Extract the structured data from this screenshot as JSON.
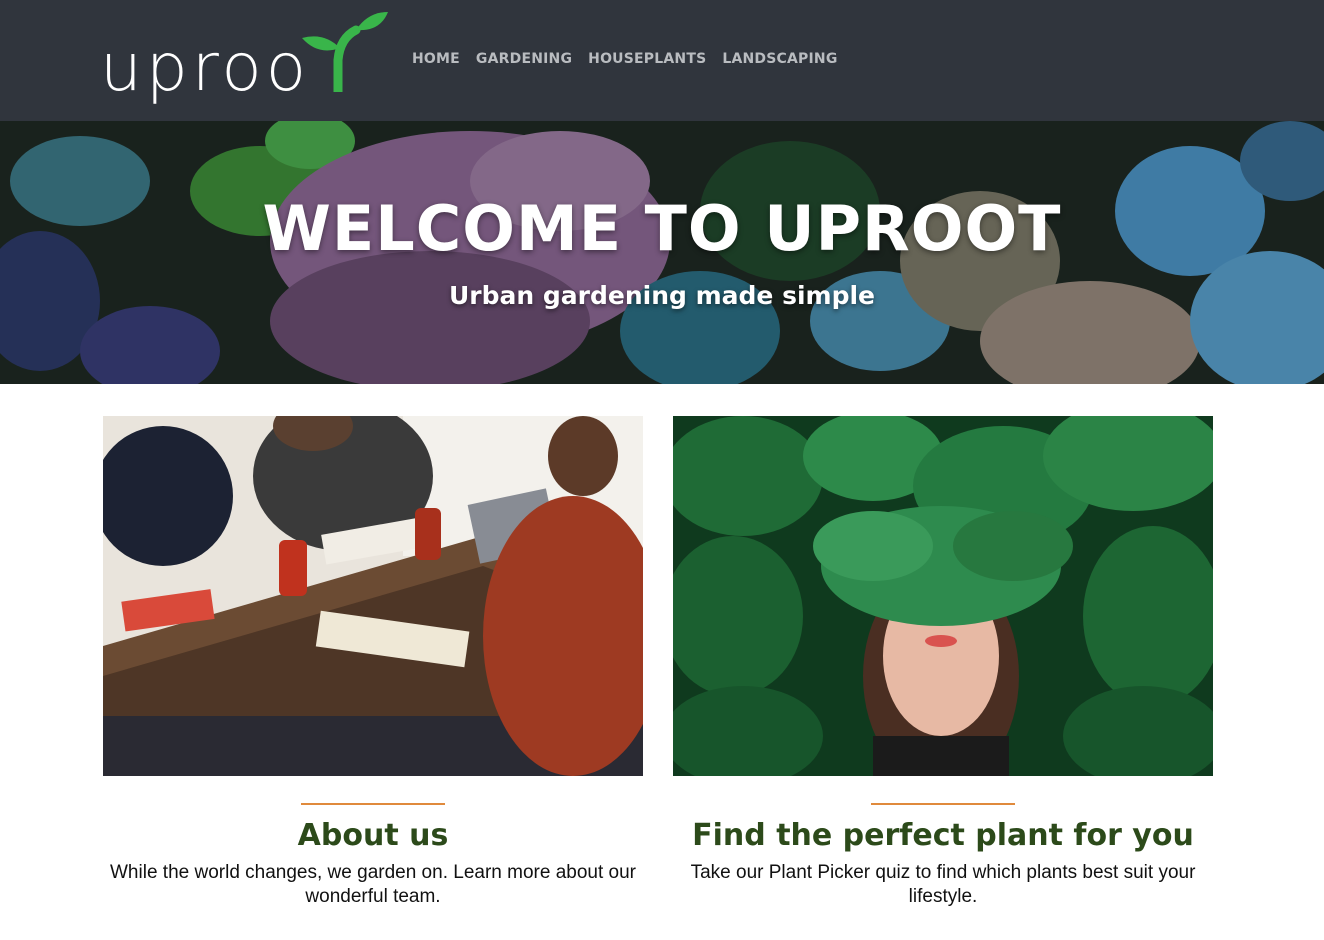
{
  "header": {
    "logo_text": "uproo",
    "logo_icon": "sprout-icon",
    "nav": [
      {
        "label": "HOME"
      },
      {
        "label": "GARDENING"
      },
      {
        "label": "HOUSEPLANTS"
      },
      {
        "label": "LANDSCAPING"
      }
    ]
  },
  "hero": {
    "title": "WELCOME TO UPROOT",
    "subtitle": "Urban gardening made simple",
    "image": "succulents-photo"
  },
  "cards": [
    {
      "image": "team-meeting-photo",
      "title": "About us",
      "text": "While the world changes, we garden on. Learn more about our wonderful team."
    },
    {
      "image": "woman-in-leaves-photo",
      "title": "Find the perfect plant for you",
      "text": "Take our Plant Picker quiz to find which plants best suit your lifestyle."
    }
  ],
  "colors": {
    "header_bg": "#30353d",
    "nav_text": "#b9bcc0",
    "logo_green": "#39b54a",
    "heading_green": "#2c4a1a",
    "accent_orange": "#e08a3c"
  }
}
